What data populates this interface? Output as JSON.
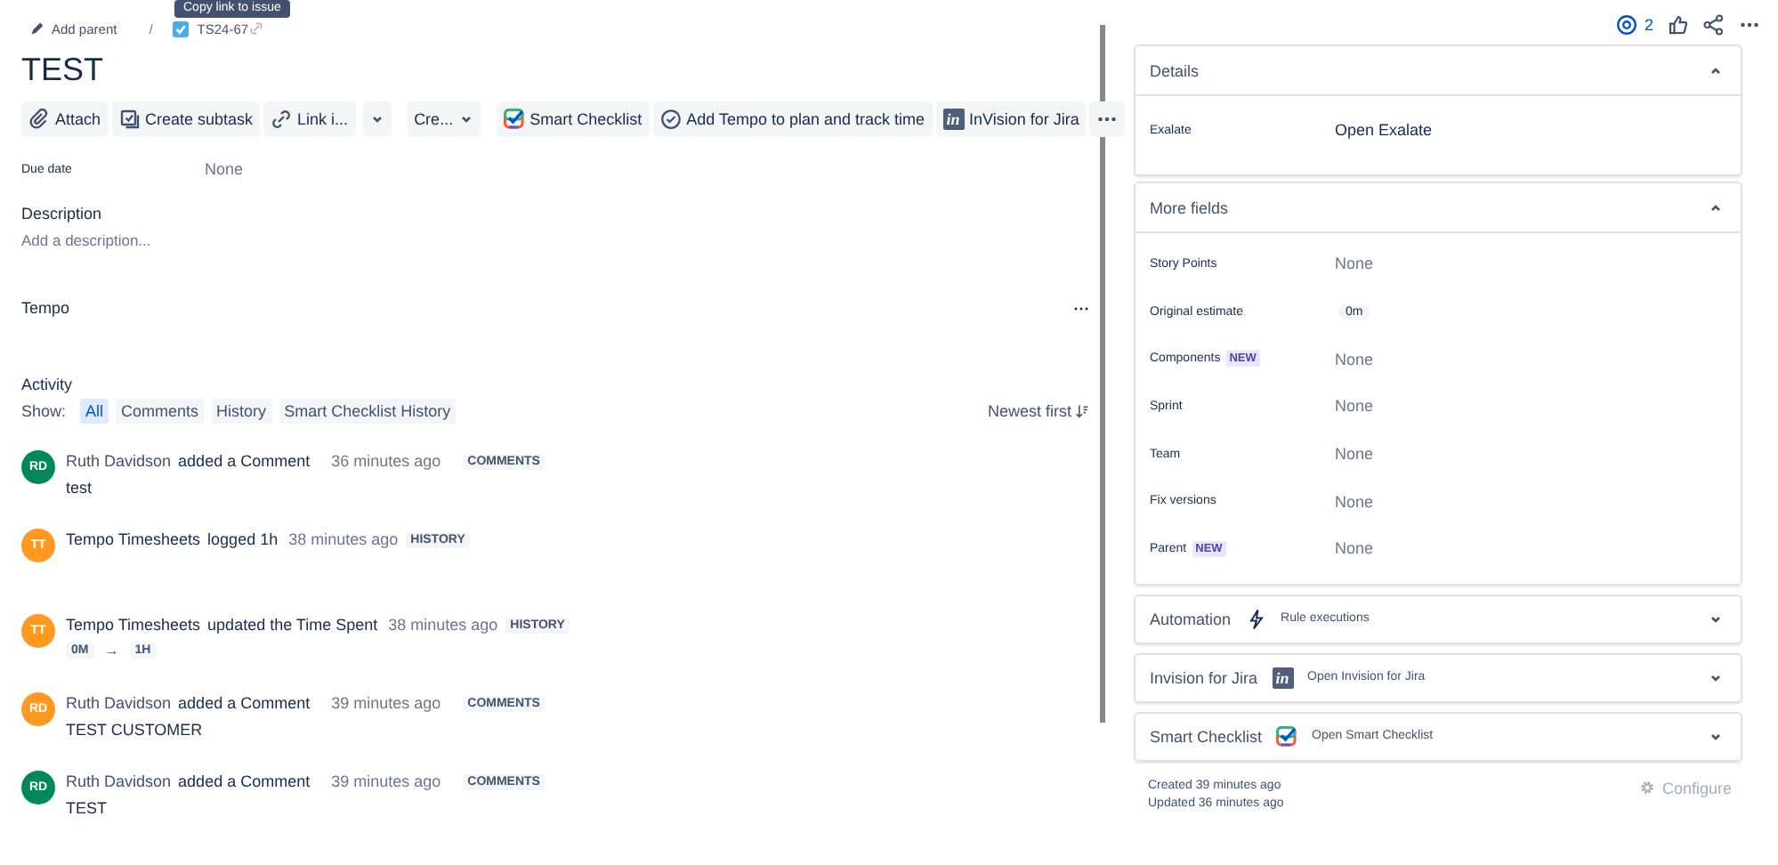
{
  "tooltip": "Copy link to issue",
  "breadcrumb": {
    "parent_link": "Add parent",
    "separator": "/",
    "issue_key": "TS24-67"
  },
  "title": "TEST",
  "toolbar": [
    {
      "kind": "attach",
      "label": "Attach"
    },
    {
      "kind": "subtask",
      "label": "Create subtask"
    },
    {
      "kind": "link",
      "label": "Link i..."
    },
    {
      "kind": "caret"
    },
    {
      "kind": "menu",
      "label": "Cre..."
    },
    {
      "kind": "checklist",
      "label": "Smart Checklist"
    },
    {
      "kind": "tempo",
      "label": "Add Tempo to plan and track time"
    },
    {
      "kind": "invision",
      "label": "InVision for Jira",
      "logo": "in"
    },
    {
      "kind": "more"
    }
  ],
  "due_date": {
    "label": "Due date",
    "value": "None"
  },
  "description": {
    "heading": "Description",
    "placeholder": "Add a description..."
  },
  "tempo": {
    "heading": "Tempo"
  },
  "activity": {
    "heading": "Activity",
    "show_label": "Show:",
    "sort": "Newest first",
    "filters": [
      {
        "label": "All",
        "selected": true
      },
      {
        "label": "Comments",
        "selected": false
      },
      {
        "label": "History",
        "selected": false
      },
      {
        "label": "Smart Checklist History",
        "selected": false
      }
    ],
    "entries": [
      {
        "kind": "comment",
        "initials": "RD",
        "color": "#00875a",
        "author": "Ruth Davidson",
        "action": "added a Comment",
        "time": "36 minutes ago",
        "badge": "COMMENTS",
        "body": "test"
      },
      {
        "kind": "history",
        "initials": "TT",
        "color": "#ff991f",
        "author": "Tempo Timesheets",
        "action": "logged 1h",
        "time": "38 minutes ago",
        "badge": "HISTORY"
      },
      {
        "kind": "change",
        "initials": "TT",
        "color": "#ff991f",
        "author": "Tempo Timesheets",
        "action": "updated the Time Spent",
        "time": "38 minutes ago",
        "badge": "HISTORY",
        "from": "0M",
        "arrow": "→",
        "to": "1H"
      },
      {
        "kind": "comment",
        "initials": "RD",
        "color": "#ff991f",
        "author": "Ruth Davidson",
        "action": "added a Comment",
        "time": "39 minutes ago",
        "badge": "COMMENTS",
        "body": "TEST CUSTOMER"
      },
      {
        "kind": "comment",
        "initials": "RD",
        "color": "#00875a",
        "author": "Ruth Davidson",
        "action": "added a Comment",
        "time": "39 minutes ago",
        "badge": "COMMENTS",
        "body": "TEST"
      }
    ]
  },
  "watchers": "2",
  "details": {
    "title": "Details",
    "expanded": true,
    "rows": [
      {
        "label": "Exalate",
        "value": "Open Exalate"
      }
    ]
  },
  "more_fields": {
    "title": "More fields",
    "expanded": true,
    "rows": [
      {
        "label": "Story Points",
        "value": "None",
        "kind": "text"
      },
      {
        "label": "Original estimate",
        "value": "0m",
        "kind": "pill"
      },
      {
        "label": "Components",
        "badge": "NEW",
        "value": "None",
        "kind": "text"
      },
      {
        "label": "Sprint",
        "value": "None",
        "kind": "text"
      },
      {
        "label": "Team",
        "value": "None",
        "kind": "text"
      },
      {
        "label": "Fix versions",
        "value": "None",
        "kind": "text"
      },
      {
        "label": "Parent",
        "badge": "NEW",
        "value": "None",
        "kind": "text"
      }
    ]
  },
  "panels": [
    {
      "kind": "automation",
      "title": "Automation",
      "link": "Rule executions",
      "expanded": false
    },
    {
      "kind": "invision",
      "title": "Invision for Jira",
      "link": "Open Invision for Jira",
      "logo": "in",
      "expanded": false
    },
    {
      "kind": "checklist",
      "title": "Smart Checklist",
      "link": "Open Smart Checklist",
      "expanded": false
    }
  ],
  "created": "Created 39 minutes ago",
  "updated": "Updated 36 minutes ago",
  "configure": "Configure"
}
